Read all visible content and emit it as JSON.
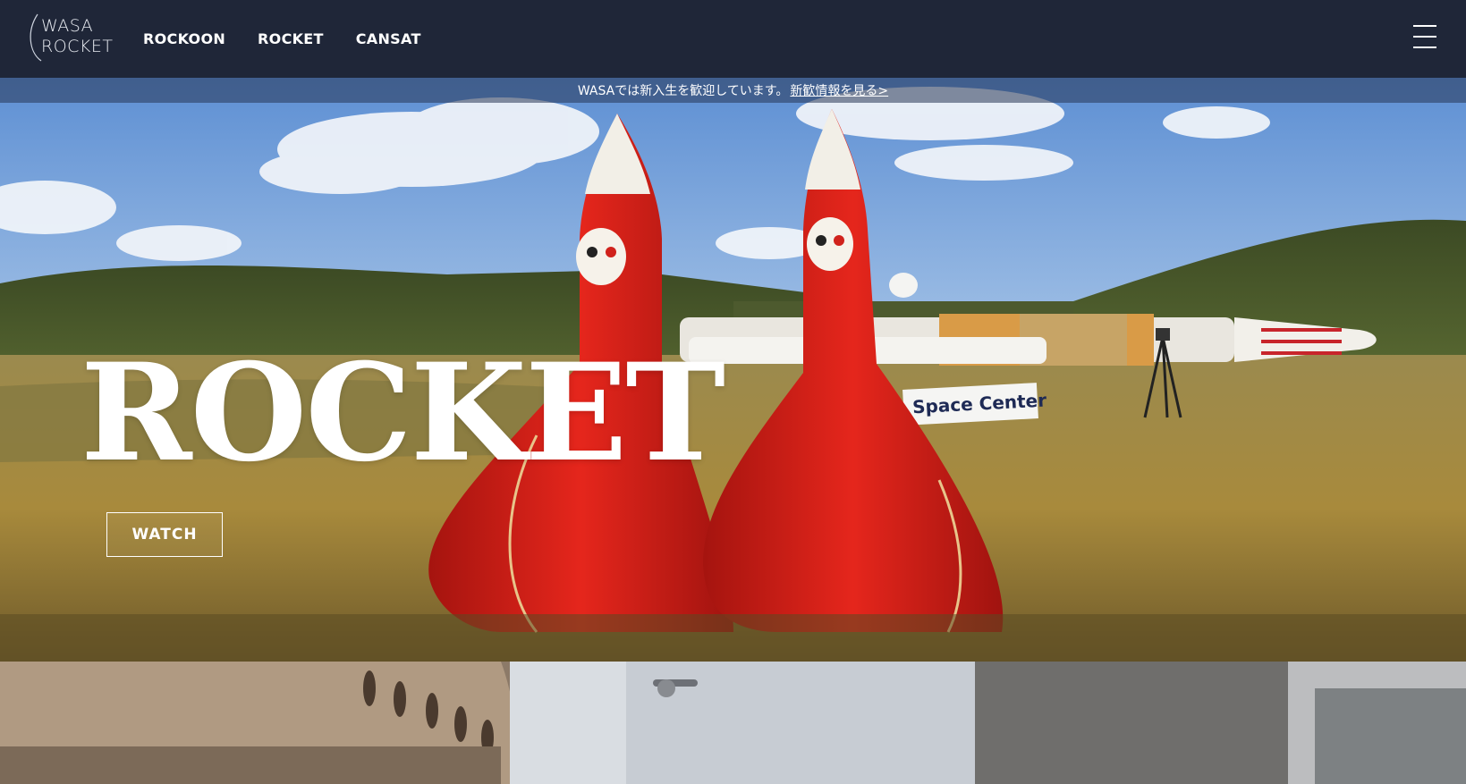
{
  "header": {
    "logo_text": "WASA\nROCKET",
    "nav": [
      {
        "label": "ROCKOON"
      },
      {
        "label": "ROCKET"
      },
      {
        "label": "CANSAT"
      }
    ]
  },
  "announcement": {
    "text": "WASAでは新入生を歓迎しています。",
    "link_label": "新歓情報を見る>"
  },
  "hero": {
    "title": "ROCKET",
    "watch_label": "WATCH",
    "sign_text": "Space Center"
  },
  "colors": {
    "header_bg": "#1f2638",
    "rocket_red": "#d7221c",
    "grass": "#a48a3f",
    "sky": "#6f9bd6"
  }
}
